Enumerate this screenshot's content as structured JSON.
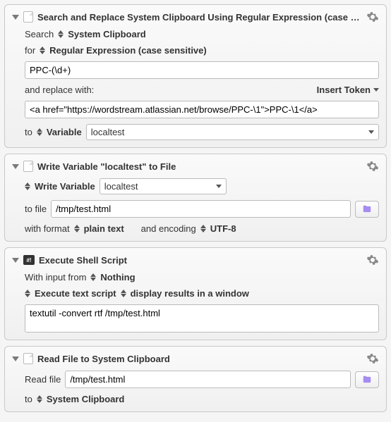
{
  "action1": {
    "title": "Search and Replace System Clipboard Using Regular Expression (case se...",
    "searchLabel": "Search",
    "systemClipboard": "System Clipboard",
    "forLabel": "for",
    "regexLabel": "Regular Expression (case sensitive)",
    "pattern": "PPC-(\\d+)",
    "replaceLabel": "and replace with:",
    "insertToken": "Insert Token",
    "replacement": "<a href=\"https://wordstream.atlassian.net/browse/PPC-\\1\">PPC-\\1</a>",
    "toLabel": "to",
    "variableLabel": "Variable",
    "variableName": "localtest"
  },
  "action2": {
    "title": "Write Variable \"localtest\" to File",
    "writeVarLabel": "Write Variable",
    "variableName": "localtest",
    "toFileLabel": "to file",
    "filePath": "/tmp/test.html",
    "withFormatLabel": "with format",
    "formatValue": "plain text",
    "encodingLabel": "and encoding",
    "encodingValue": "UTF-8"
  },
  "action3": {
    "title": "Execute Shell Script",
    "inputLabel": "With input from",
    "inputValue": "Nothing",
    "execLabel": "Execute text script",
    "displayLabel": "display results in a window",
    "script": "textutil -convert rtf /tmp/test.html"
  },
  "action4": {
    "title": "Read File to System Clipboard",
    "readLabel": "Read file",
    "filePath": "/tmp/test.html",
    "toLabel": "to",
    "destLabel": "System Clipboard"
  }
}
